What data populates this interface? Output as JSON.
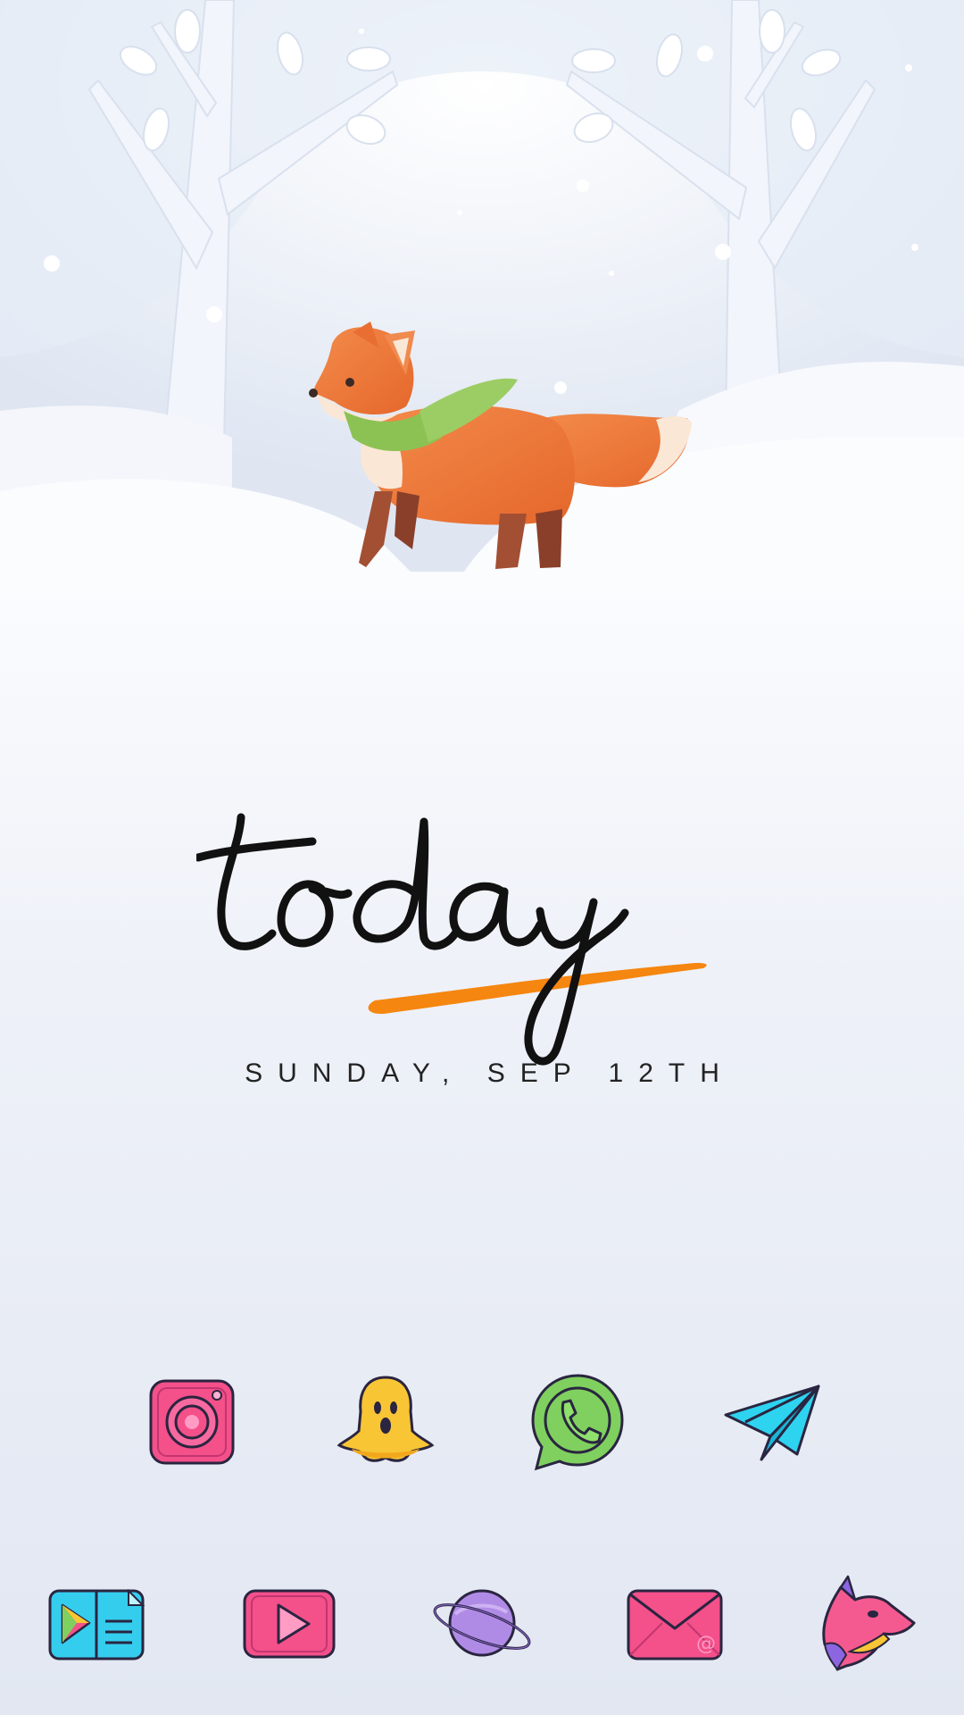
{
  "widget": {
    "word": "today",
    "date": "SUNDAY, SEP 12TH",
    "underline_color": "#f5860f"
  },
  "wallpaper": {
    "scene": "fox-in-snow",
    "colors": {
      "fox": "#ee7a3a",
      "scarf": "#8cc254",
      "sky": "#e8eef7"
    }
  },
  "dock_row1": [
    {
      "name": "camera-app",
      "icon": "camera-icon",
      "color": "#f4508a"
    },
    {
      "name": "ghost-app",
      "icon": "ghost-icon",
      "color": "#f8c535"
    },
    {
      "name": "chat-app",
      "icon": "phone-bubble-icon",
      "color": "#7fd05e"
    },
    {
      "name": "send-app",
      "icon": "paper-plane-icon",
      "color": "#2ed3f0"
    }
  ],
  "dock_row2": [
    {
      "name": "store-app",
      "icon": "play-store-icon",
      "color": "#35cdee"
    },
    {
      "name": "video-app",
      "icon": "play-button-icon",
      "color": "#f4508a"
    },
    {
      "name": "planet-app",
      "icon": "planet-icon",
      "color": "#b08be6"
    },
    {
      "name": "mail-app",
      "icon": "mail-icon",
      "color": "#f4508a"
    },
    {
      "name": "fox-app",
      "icon": "fox-head-icon",
      "color": "#f45a8f"
    }
  ]
}
